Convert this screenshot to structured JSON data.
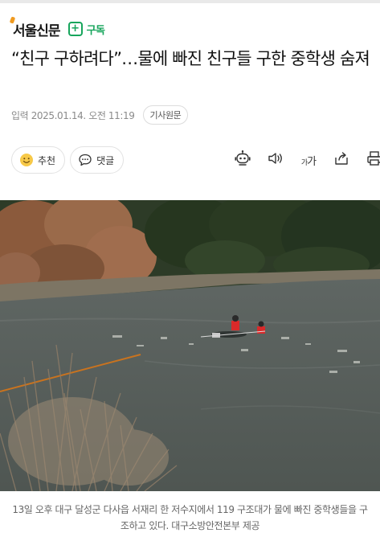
{
  "publisher": {
    "name": "서울신문",
    "subscribe_label": "구독"
  },
  "article": {
    "headline": "“친구 구하려다”…물에 빠진 친구들 구한 중학생 숨져",
    "date": "입력 2025.01.14. 오전 11:19",
    "original_button": "기사원문"
  },
  "actions": {
    "recommend_label": "추천",
    "comment_label": "댓글"
  },
  "toolbar": {
    "icons": [
      "robot-summary-icon",
      "speaker-icon",
      "font-size-icon",
      "share-icon",
      "print-icon"
    ],
    "font_small": "가",
    "font_large": "가"
  },
  "photo": {
    "caption": "13일 오후 대구 달성군 다사읍 서재리 한 저수지에서 119 구조대가 물에 빠진 중학생들을 구조하고 있다. 대구소방안전본부 제공"
  },
  "colors": {
    "accent": "#17a55c",
    "logo_dot": "#f09a1f"
  }
}
